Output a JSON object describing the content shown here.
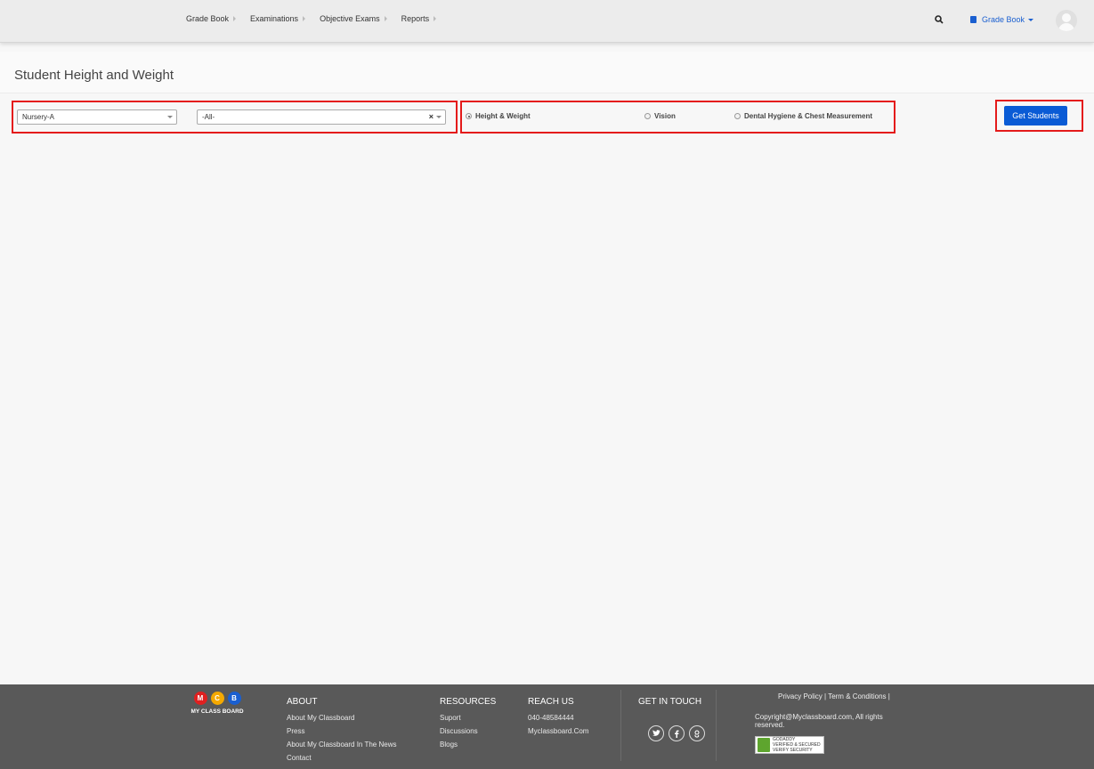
{
  "nav": {
    "items": [
      "Grade Book",
      "Examinations",
      "Objective Exams",
      "Reports"
    ],
    "module_menu": "Grade Book"
  },
  "page": {
    "title": "Student Height and Weight"
  },
  "filters": {
    "class_select": "Nursery-A",
    "section_select": "-All-",
    "clear_glyph": "×",
    "radio_options": [
      "Height & Weight",
      "Vision",
      "Dental Hygiene & Chest Measurement"
    ],
    "selected_radio": "Height & Weight",
    "submit_label": "Get Students"
  },
  "footer": {
    "logo_letters": [
      "M",
      "C",
      "B"
    ],
    "logo_text": "MY CLASS BOARD",
    "about": {
      "heading": "ABOUT",
      "links": [
        "About My Classboard",
        "Press",
        "About My Classboard In The News",
        "Contact"
      ]
    },
    "resources": {
      "heading": "RESOURCES",
      "links": [
        "Suport",
        "Discussions",
        "Blogs"
      ]
    },
    "reach": {
      "heading": "REACH US",
      "phone": "040-48584444",
      "site": "Myclassboard.Com"
    },
    "touch": {
      "heading": "GET IN TOUCH",
      "icons": [
        "twitter-icon",
        "facebook-icon",
        "google-plus-icon"
      ]
    },
    "legal": {
      "privacy": "Privacy Policy",
      "terms": "Term & Conditions",
      "separator": "|"
    },
    "copyright": "Copyright@Myclassboard.com, All rights reserved.",
    "seal": {
      "line1": "GODADDY",
      "line2": "VERIFIED & SECURED",
      "line3": "VERIFY SECURITY"
    }
  },
  "colors": {
    "accent": "#0a5bd5",
    "highlight_border": "#e41b1b",
    "footer_bg": "#595959",
    "logo_m": "#e02020",
    "logo_c": "#f4a900",
    "logo_b": "#1a5fd0"
  }
}
